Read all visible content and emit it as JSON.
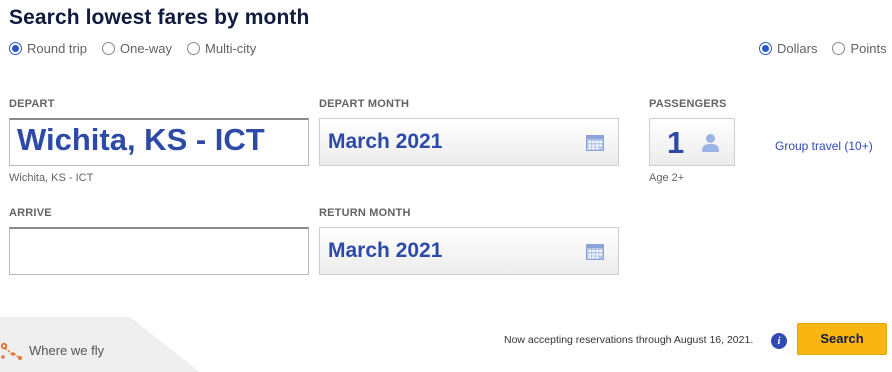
{
  "page_title": "Search lowest fares by month",
  "trip_type": {
    "options": [
      "Round trip",
      "One-way",
      "Multi-city"
    ],
    "selected": "Round trip"
  },
  "currency": {
    "options": [
      "Dollars",
      "Points"
    ],
    "selected": "Dollars"
  },
  "depart": {
    "label": "DEPART",
    "value": "Wichita, KS - ICT",
    "sublabel": "Wichita, KS - ICT"
  },
  "arrive": {
    "label": "ARRIVE",
    "value": ""
  },
  "depart_month": {
    "label": "DEPART MONTH",
    "value": "March 2021",
    "icon": "calendar-icon"
  },
  "return_month": {
    "label": "RETURN MONTH",
    "value": "March 2021",
    "icon": "calendar-icon"
  },
  "passengers": {
    "label": "PASSENGERS",
    "count": "1",
    "age_note": "Age 2+",
    "icon": "person-icon"
  },
  "group_travel_link": "Group travel (10+)",
  "where_we_fly": {
    "label": "Where we fly",
    "icon": "route-map-icon"
  },
  "notice": "Now accepting reservations through August 16, 2021.",
  "info_icon_glyph": "i",
  "search_button": "Search",
  "colors": {
    "navy": "#111b40",
    "blue": "#304cb2",
    "value_blue": "#2d4aa8",
    "yellow": "#f9b612",
    "route_orange": "#e8743b"
  }
}
